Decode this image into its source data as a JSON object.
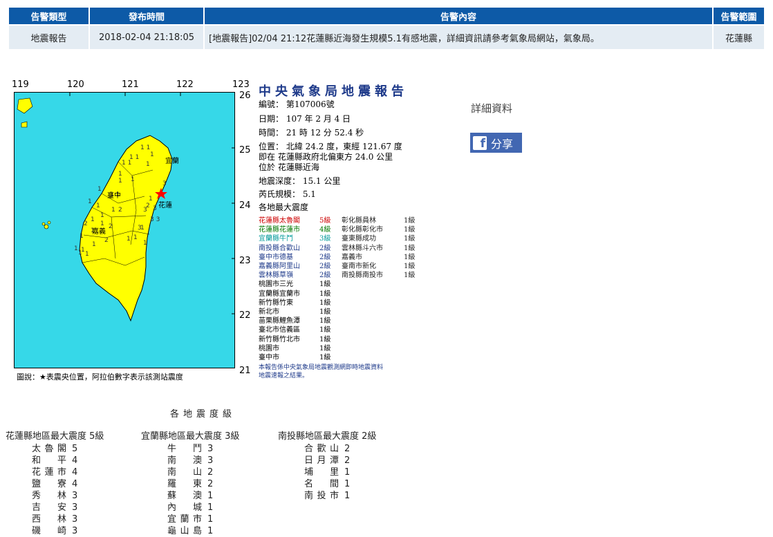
{
  "alert_table": {
    "headers": [
      "告警類型",
      "發布時間",
      "告警內容",
      "告警範圍"
    ],
    "row": {
      "type": "地震報告",
      "time": "2018-02-04 21:18:05",
      "content": "[地震報告]02/04 21:12花蓮縣近海發生規模5.1有感地震，詳細資訊請參考氣象局網站，氣象局。",
      "area": "花蓮縣"
    }
  },
  "map": {
    "lon_labels": [
      "119",
      "120",
      "121",
      "122",
      "123"
    ],
    "lat_labels": [
      "26",
      "25",
      "24",
      "23",
      "22",
      "21"
    ],
    "cities": [
      "宜蘭",
      "花蓮",
      "臺中",
      "嘉義"
    ],
    "legend": "圖說：★表震央位置，阿拉伯數字表示該測站震度"
  },
  "report": {
    "title": "中央氣象局地震報告",
    "number": "編號： 第107006號",
    "date": "日期： 107 年 2 月 4 日",
    "time": "時間： 21 時 12 分 52.4 秒",
    "position": "位置： 北緯 24.2 度，東經 121.67 度",
    "relative": "即在 花蓮縣政府北偏東方 24.0 公里",
    "located": "位於 花蓮縣近海",
    "depth": "地震深度： 15.1 公里",
    "magnitude": "芮氏規模： 5.1",
    "max_intensity_label": "各地最大震度",
    "left_list": [
      {
        "name": "花蓮縣太魯閣",
        "level": "5級",
        "color": "#cc0000"
      },
      {
        "name": "花蓮縣花蓮市",
        "level": "4級",
        "color": "#007700"
      },
      {
        "name": "宜蘭縣牛鬥",
        "level": "3級",
        "color": "#009999"
      },
      {
        "name": "南投縣合歡山",
        "level": "2級",
        "color": "#1e3a8a"
      },
      {
        "name": "臺中市德基",
        "level": "2級",
        "color": "#1e3a8a"
      },
      {
        "name": "嘉義縣阿里山",
        "level": "2級",
        "color": "#1e3a8a"
      },
      {
        "name": "雲林縣草嶺",
        "level": "2級",
        "color": "#1e3a8a"
      },
      {
        "name": "桃園市三光",
        "level": "1級",
        "color": "#000000"
      },
      {
        "name": "宜蘭縣宜蘭市",
        "level": "1級",
        "color": "#000000"
      },
      {
        "name": "新竹縣竹東",
        "level": "1級",
        "color": "#000000"
      },
      {
        "name": "新北市",
        "level": "1級",
        "color": "#000000"
      },
      {
        "name": "苗栗縣鯉魚潭",
        "level": "1級",
        "color": "#000000"
      },
      {
        "name": "臺北市信義區",
        "level": "1級",
        "color": "#000000"
      },
      {
        "name": "新竹縣竹北市",
        "level": "1級",
        "color": "#000000"
      },
      {
        "name": "桃園市",
        "level": "1級",
        "color": "#000000"
      },
      {
        "name": "臺中市",
        "level": "1級",
        "color": "#000000"
      }
    ],
    "right_list": [
      {
        "name": "彰化縣員林",
        "level": "1級"
      },
      {
        "name": "彰化縣彰化市",
        "level": "1級"
      },
      {
        "name": "臺東縣成功",
        "level": "1級"
      },
      {
        "name": "雲林縣斗六市",
        "level": "1級"
      },
      {
        "name": "嘉義市",
        "level": "1級"
      },
      {
        "name": "臺南市新化",
        "level": "1級"
      },
      {
        "name": "南投縣南投市",
        "level": "1級"
      }
    ],
    "note": "本報告係中央氣象局地震觀測網即時地震資料\n地震速報之結果。"
  },
  "side": {
    "detail_label": "詳細資料",
    "share_label": "分享"
  },
  "intensity_section": {
    "title": "各地震度級",
    "columns": [
      {
        "header": "花蓮縣地區最大震度 5級",
        "rows": [
          {
            "name": "太魯閣",
            "level": "5"
          },
          {
            "name": "和平",
            "level": "4"
          },
          {
            "name": "花蓮市",
            "level": "4"
          },
          {
            "name": "鹽寮",
            "level": "4"
          },
          {
            "name": "秀林",
            "level": "3"
          },
          {
            "name": "吉安",
            "level": "3"
          },
          {
            "name": "西林",
            "level": "3"
          },
          {
            "name": "磯崎",
            "level": "3"
          }
        ]
      },
      {
        "header": "宜蘭縣地區最大震度 3級",
        "rows": [
          {
            "name": "牛鬥",
            "level": "3"
          },
          {
            "name": "南澳",
            "level": "3"
          },
          {
            "name": "南山",
            "level": "2"
          },
          {
            "name": "羅東",
            "level": "2"
          },
          {
            "name": "蘇澳",
            "level": "1"
          },
          {
            "name": "內城",
            "level": "1"
          },
          {
            "name": "宜蘭市",
            "level": "1"
          },
          {
            "name": "龜山島",
            "level": "1"
          }
        ]
      },
      {
        "header": "南投縣地區最大震度 2級",
        "rows": [
          {
            "name": "合歡山",
            "level": "2"
          },
          {
            "name": "日月潭",
            "level": "2"
          },
          {
            "name": "埔里",
            "level": "1"
          },
          {
            "name": "名間",
            "level": "1"
          },
          {
            "name": "南投市",
            "level": "1"
          }
        ]
      }
    ]
  },
  "colors": {
    "header_bg": "#0d5aa7",
    "row_bg": "#e4ecf3",
    "sea": "#36d8e8",
    "land": "#ffff00",
    "star": "#ff0000",
    "share": "#4267b2"
  }
}
